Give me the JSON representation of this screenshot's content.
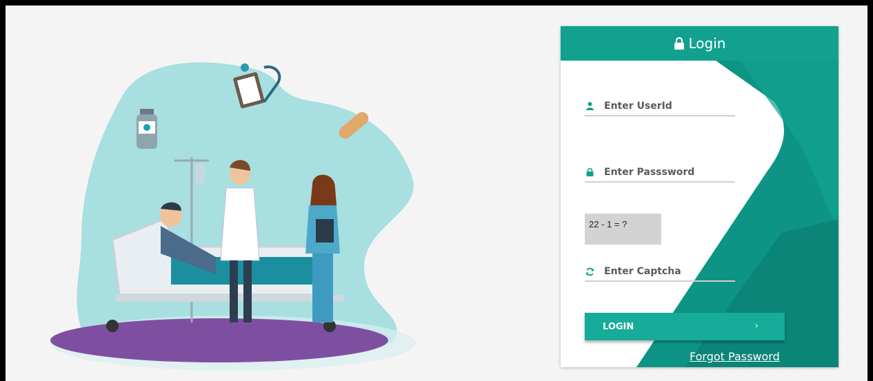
{
  "login": {
    "title": "Login",
    "userid_placeholder": "Enter UserId",
    "password_placeholder": "Enter Passsword",
    "captcha_question": "22 - 1 = ?",
    "captcha_placeholder": "Enter Captcha",
    "login_button": "LOGIN",
    "forgot_password": "Forgot Password",
    "icons": [
      "lock-icon",
      "user-icon",
      "password-lock-icon",
      "refresh-icon",
      "chevron-right-icon"
    ]
  },
  "colors": {
    "primary": "#12a08f",
    "primary_dark": "#0b7d70",
    "background": "#f4f4f4",
    "illustration_teal": "#a8dfe0",
    "floor_purple": "#7e4fa0"
  }
}
